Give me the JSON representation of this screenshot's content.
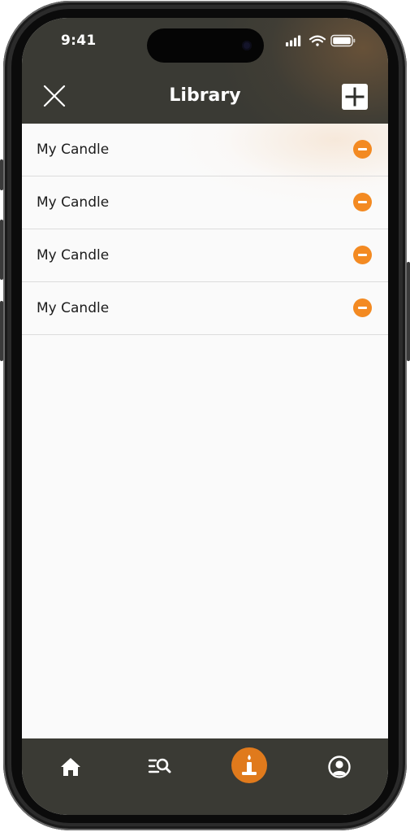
{
  "status_bar": {
    "time": "9:41"
  },
  "header": {
    "title": "Library",
    "close_icon": "close-icon",
    "add_icon": "plus-icon"
  },
  "library": {
    "items": [
      {
        "label": "My Candle",
        "action_icon": "remove-circle-icon"
      },
      {
        "label": "My Candle",
        "action_icon": "remove-circle-icon"
      },
      {
        "label": "My Candle",
        "action_icon": "remove-circle-icon"
      },
      {
        "label": "My Candle",
        "action_icon": "remove-circle-icon"
      }
    ]
  },
  "tab_bar": {
    "tabs": [
      {
        "icon": "home-icon",
        "active": false
      },
      {
        "icon": "search-list-icon",
        "active": false
      },
      {
        "icon": "candle-icon",
        "active": true
      },
      {
        "icon": "profile-icon",
        "active": false
      }
    ]
  },
  "colors": {
    "header_bg": "#3a3a34",
    "accent": "#f38a22",
    "active_tab": "#e07a1c",
    "screen_bg": "#fafafa",
    "divider": "#dcdcdc"
  }
}
